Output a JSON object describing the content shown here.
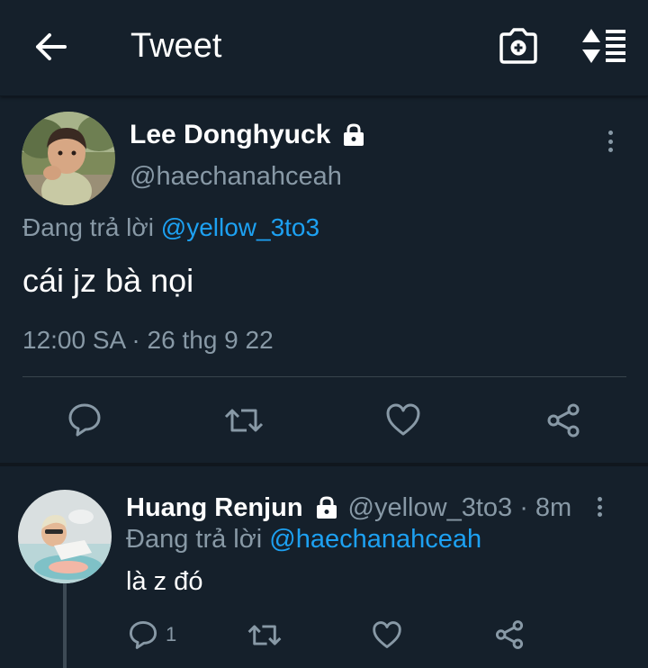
{
  "header": {
    "title": "Tweet",
    "back_icon": "arrow-left-icon",
    "camera_icon": "camera-add-icon",
    "sort_icon": "sort-list-icon"
  },
  "main_tweet": {
    "name": "Lee Donghyuck",
    "handle": "@haechanahceah",
    "reply_prefix": "Đang trả lời",
    "reply_to": "@yellow_3to3",
    "text": "cái jz bà nọi",
    "timestamp": "12:00 SA · 26 thg 9 22",
    "protected_icon": "lock-icon"
  },
  "reply_tweet": {
    "name": "Huang Renjun",
    "handle_time": "@yellow_3to3 · 8m",
    "reply_prefix": "Đang trả lời",
    "reply_to": "@haechanahceah",
    "text": "là z đó",
    "reply_count": "1",
    "protected_icon": "lock-icon"
  },
  "colors": {
    "background": "#15202b",
    "secondary_text": "#8899a6",
    "accent": "#1da1f2",
    "divider": "#38444d"
  }
}
